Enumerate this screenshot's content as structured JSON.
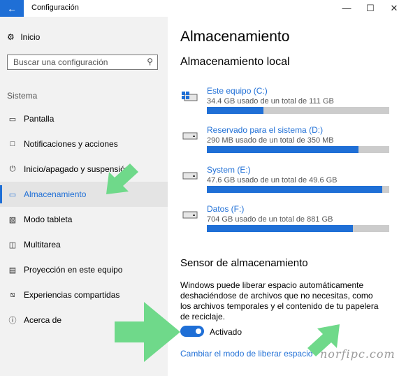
{
  "window": {
    "title": "Configuración",
    "back_icon": "arrow-left-icon",
    "controls": [
      "—",
      "☐",
      "✕"
    ]
  },
  "sidebar": {
    "home_label": "Inicio",
    "search_placeholder": "Buscar una configuración",
    "section_label": "Sistema",
    "items": [
      {
        "label": "Pantalla",
        "icon": "display-icon",
        "active": false
      },
      {
        "label": "Notificaciones y acciones",
        "icon": "notifications-icon",
        "active": false
      },
      {
        "label": "Inicio/apagado y suspensión",
        "icon": "power-icon",
        "active": false
      },
      {
        "label": "Almacenamiento",
        "icon": "storage-icon",
        "active": true
      },
      {
        "label": "Modo tableta",
        "icon": "tablet-icon",
        "active": false
      },
      {
        "label": "Multitarea",
        "icon": "multitask-icon",
        "active": false
      },
      {
        "label": "Proyección en este equipo",
        "icon": "projection-icon",
        "active": false
      },
      {
        "label": "Experiencias compartidas",
        "icon": "shared-icon",
        "active": false
      },
      {
        "label": "Acerca de",
        "icon": "info-icon",
        "active": false
      }
    ]
  },
  "main": {
    "title": "Almacenamiento",
    "local_title": "Almacenamiento local",
    "drives": [
      {
        "name": "Este equipo (C:)",
        "usage": "34.4 GB usado de un total de 111 GB",
        "used_fraction": 0.31,
        "icon": "windows-drive-icon"
      },
      {
        "name": "Reservado para el sistema (D:)",
        "usage": "290 MB usado de un total de 350 MB",
        "used_fraction": 0.83,
        "icon": "drive-icon"
      },
      {
        "name": "System (E:)",
        "usage": "47.6 GB usado de un total de 49.6 GB",
        "used_fraction": 0.96,
        "icon": "drive-icon"
      },
      {
        "name": "Datos (F:)",
        "usage": "704 GB usado de un total de 881 GB",
        "used_fraction": 0.8,
        "icon": "drive-icon"
      }
    ],
    "sensor_title": "Sensor de almacenamiento",
    "sensor_description": "Windows puede liberar espacio automáticamente deshaciéndose de archivos que no necesitas, como los archivos temporales y el contenido de tu papelera de reciclaje.",
    "toggle_state": "Activado",
    "change_link": "Cambiar el modo de liberar espacio"
  },
  "watermark": "norfipc.com",
  "colors": {
    "accent": "#1f6fd6",
    "arrow": "#6fd98a",
    "bar_bg": "#cccccc",
    "sidebar_bg": "#f2f2f2"
  }
}
